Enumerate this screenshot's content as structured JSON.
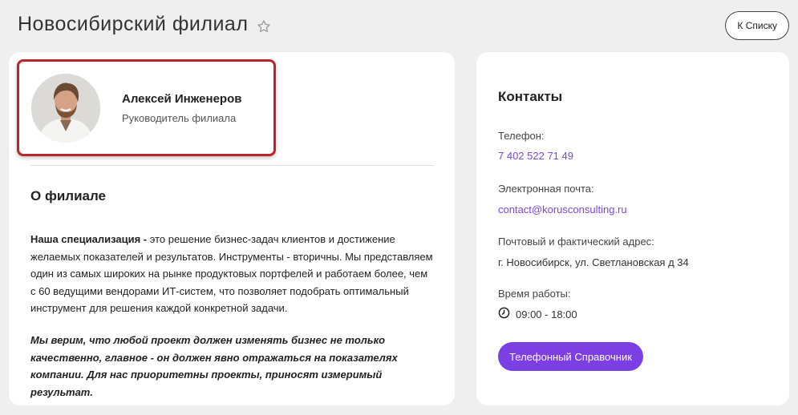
{
  "header": {
    "title": "Новосибирский филиал",
    "back_label": "К Списку"
  },
  "profile": {
    "name": "Алексей Инженеров",
    "role": "Руководитель филиала"
  },
  "about": {
    "title": "О филиале",
    "p1_bold": "Наша специализация -",
    "p1_text": " это решение бизнес-задач клиентов и достижение желаемых показателей и результатов. Инструменты - вторичны. Мы представляем один из самых широких на рынке продуктовых портфелей и работаем более, чем с 60 ведущими вендорами ИТ-систем, что позволяет подобрать оптимальный инструмент для решения каждой конкретной задачи.",
    "p2": "Мы верим, что любой проект должен изменять бизнес не только качественно, главное - он должен явно отражаться на показателях компании. Для нас приоритетны проекты, приносят измеримый результат."
  },
  "contacts": {
    "title": "Контакты",
    "phone_label": "Телефон:",
    "phone": "7 402 522 71 49",
    "email_label": "Электронная почта:",
    "email": "contact@korusconsulting.ru",
    "address_label": "Почтовый и фактический адрес:",
    "address": "г. Новосибирск, ул. Светлановская д 34",
    "hours_label": "Время работы:",
    "hours": "09:00 - 18:00",
    "phonebook_label": "Телефонный Справочник"
  },
  "colors": {
    "accent": "#7b3fe4",
    "link": "#7a48d6",
    "highlight_border": "#b8262b"
  }
}
